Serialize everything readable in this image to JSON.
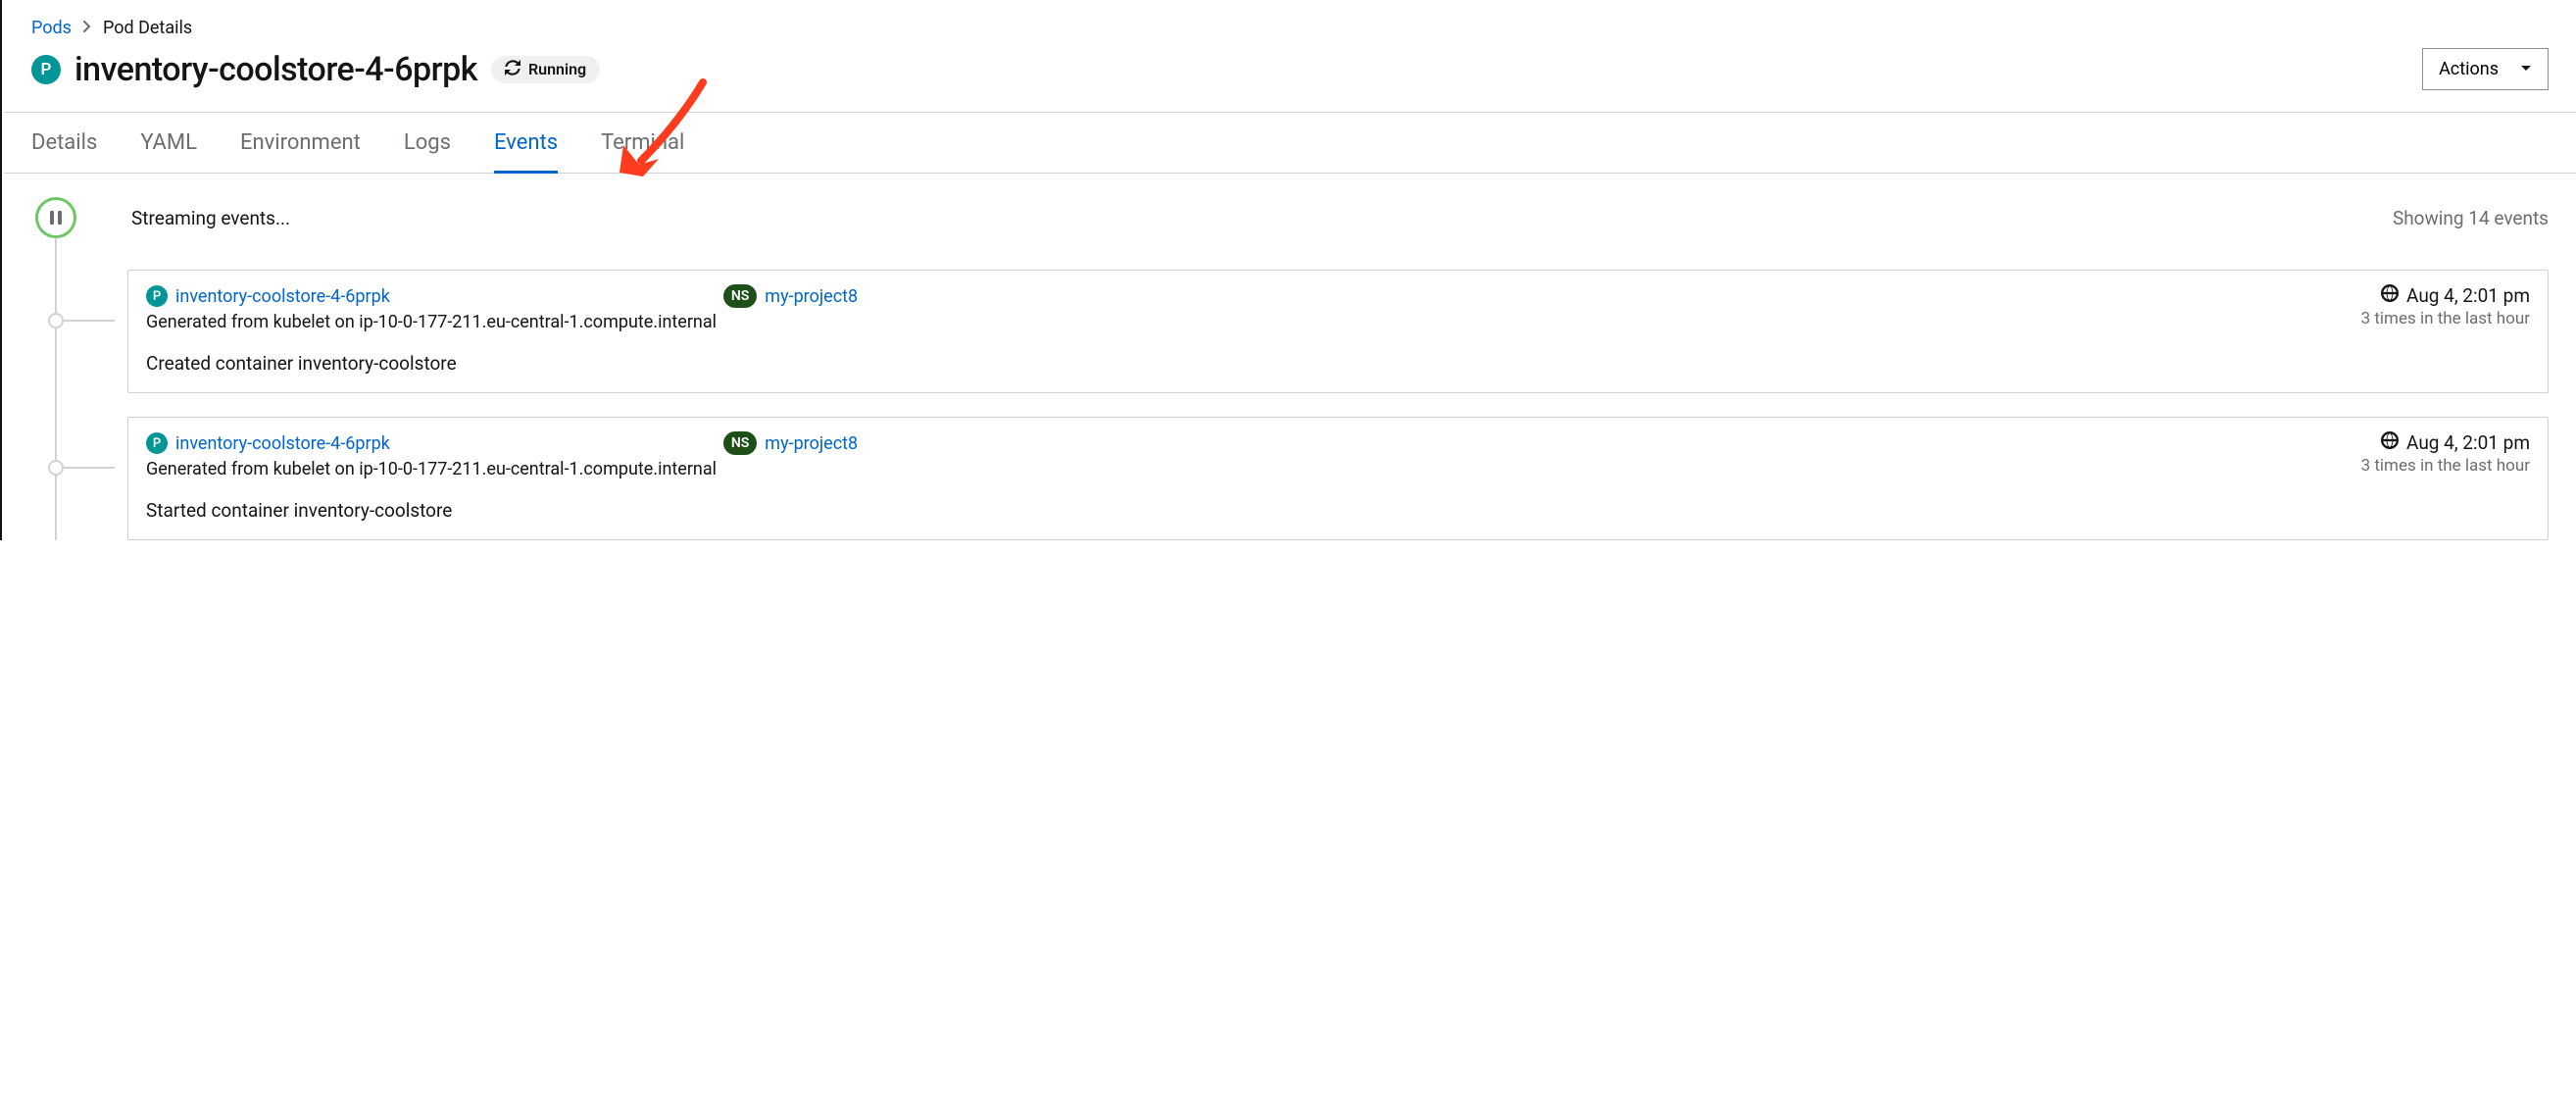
{
  "breadcrumb": {
    "parent": "Pods",
    "current": "Pod Details"
  },
  "header": {
    "badge": "P",
    "title": "inventory-coolstore-4-6prpk",
    "status_label": "Running",
    "actions_label": "Actions"
  },
  "tabs": [
    {
      "label": "Details",
      "active": false
    },
    {
      "label": "YAML",
      "active": false
    },
    {
      "label": "Environment",
      "active": false
    },
    {
      "label": "Logs",
      "active": false
    },
    {
      "label": "Events",
      "active": true
    },
    {
      "label": "Terminal",
      "active": false
    }
  ],
  "events_header": {
    "streaming_label": "Streaming events...",
    "count_label": "Showing 14 events"
  },
  "events": [
    {
      "pod_badge": "P",
      "pod_name": "inventory-coolstore-4-6prpk",
      "ns_badge": "NS",
      "ns_name": "my-project8",
      "timestamp": "Aug 4, 2:01 pm",
      "repeat": "3 times in the last hour",
      "source": "Generated from kubelet on ip-10-0-177-211.eu-central-1.compute.internal",
      "message": "Created container inventory-coolstore"
    },
    {
      "pod_badge": "P",
      "pod_name": "inventory-coolstore-4-6prpk",
      "ns_badge": "NS",
      "ns_name": "my-project8",
      "timestamp": "Aug 4, 2:01 pm",
      "repeat": "3 times in the last hour",
      "source": "Generated from kubelet on ip-10-0-177-211.eu-central-1.compute.internal",
      "message": "Started container inventory-coolstore"
    }
  ]
}
